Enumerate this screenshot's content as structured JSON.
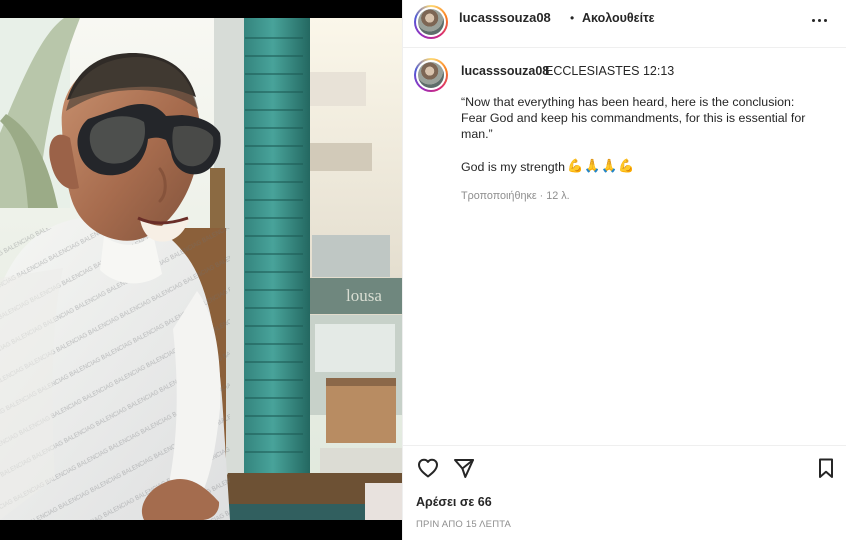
{
  "header": {
    "username": "lucasssouza08",
    "separator": "•",
    "follow_label": "Ακολουθείτε",
    "avatar_icon": "avatar-icon",
    "more_icon": "more-options-icon"
  },
  "caption": {
    "username": "lucasssouza08",
    "title": "ECCLESIASTES 12:13",
    "quote": "“Now that everything has been heard, here is the conclusion: Fear God and keep his commandments, for this is essential for man.”",
    "strength_text": "God is my strength",
    "emojis": [
      "💪",
      "🙏",
      "🙏",
      "💪"
    ],
    "edited": "Τροποποιήθηκε · 12 λ."
  },
  "actions": {
    "like_icon": "heart-icon",
    "share_icon": "send-icon",
    "save_icon": "bookmark-icon",
    "likes_text": "Αρέσει σε 66",
    "timestamp": "ΠΡΙΝ ΑΠΟ 15 ΛΕΠΤΑ"
  },
  "photo": {
    "description": "selfie-photo"
  }
}
